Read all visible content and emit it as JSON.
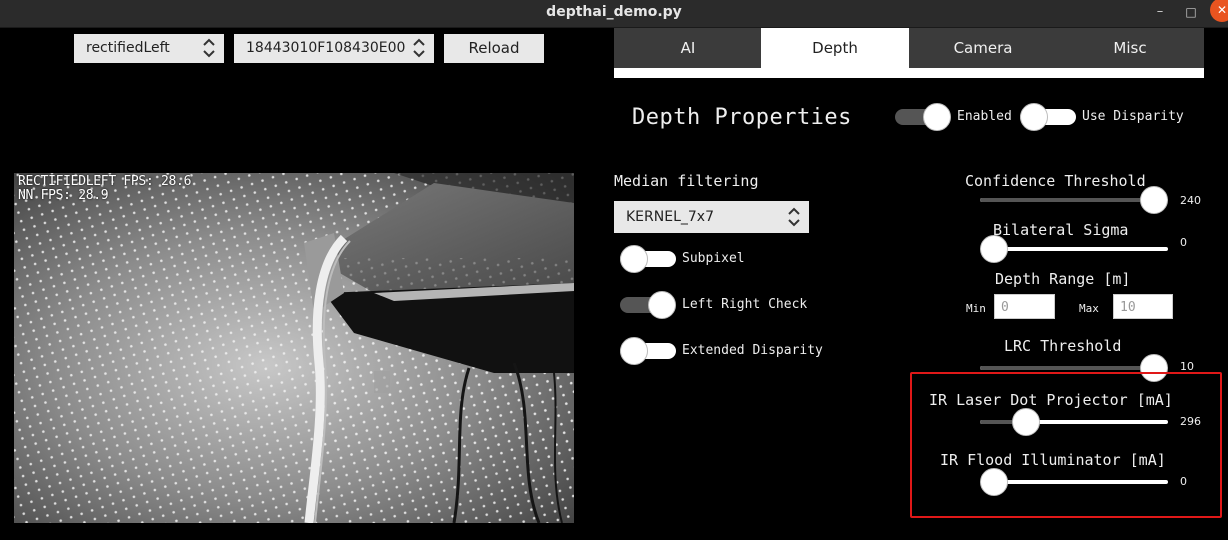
{
  "window": {
    "title": "depthai_demo.py",
    "minimize": "–",
    "maximize": "□",
    "close": "✕"
  },
  "toolbar": {
    "preview_select": "rectifiedLeft",
    "device_select": "18443010F108430E00",
    "reload_label": "Reload"
  },
  "preview": {
    "fps_line1": "RECTIFIEDLEFT FPS: 28.6",
    "fps_line2": "NN FPS:  28.9"
  },
  "tabs": [
    {
      "label": "AI",
      "active": false
    },
    {
      "label": "Depth",
      "active": true
    },
    {
      "label": "Camera",
      "active": false
    },
    {
      "label": "Misc",
      "active": false
    }
  ],
  "depth": {
    "title": "Depth Properties",
    "enabled_label": "Enabled",
    "enabled_on": true,
    "use_disparity_label": "Use Disparity",
    "use_disparity_on": false,
    "median_label": "Median filtering",
    "median_value": "KERNEL_7x7",
    "subpixel_label": "Subpixel",
    "subpixel_on": false,
    "lrcheck_label": "Left Right Check",
    "lrcheck_on": true,
    "extended_label": "Extended Disparity",
    "extended_on": false,
    "confidence": {
      "label": "Confidence Threshold",
      "value": "240",
      "min": 0,
      "max": 255,
      "level": 240
    },
    "bilateral": {
      "label": "Bilateral Sigma",
      "value": "0",
      "min": 0,
      "max": 250,
      "level": 0
    },
    "range": {
      "label": "Depth Range [m]",
      "min_label": "Min",
      "min_value": "0",
      "max_label": "Max",
      "max_value": "10"
    },
    "lrc": {
      "label": "LRC Threshold",
      "value": "10",
      "min": 0,
      "max": 10,
      "level": 10
    },
    "ir_laser": {
      "label": "IR Laser Dot Projector [mA]",
      "value": "296",
      "min": 0,
      "max": 1200,
      "level": 296
    },
    "ir_flood": {
      "label": "IR Flood Illuminator [mA]",
      "value": "0",
      "min": 0,
      "max": 1500,
      "level": 0
    }
  },
  "colors": {
    "highlight": "#e01818",
    "close_button": "#e95420"
  }
}
